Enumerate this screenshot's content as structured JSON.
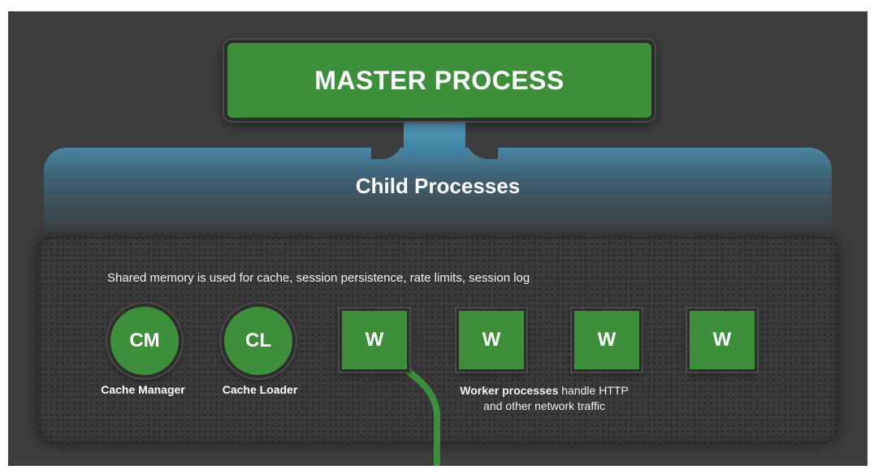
{
  "master": {
    "label": "MASTER PROCESS"
  },
  "child": {
    "title": "Child Processes"
  },
  "shared_memory_text": "Shared memory is used for cache, session persistence, rate limits, session log",
  "nodes": [
    {
      "id": "CM",
      "label": "Cache Manager"
    },
    {
      "id": "CL",
      "label": "Cache Loader"
    }
  ],
  "workers": [
    "W",
    "W",
    "W",
    "W"
  ],
  "worker_caption": {
    "bold": "Worker processes",
    "rest": " handle HTTP",
    "line2": "and other network traffic"
  },
  "colors": {
    "green": "#3e8f3b",
    "blue": "#4a86a3",
    "background": "#3d3d3d"
  }
}
